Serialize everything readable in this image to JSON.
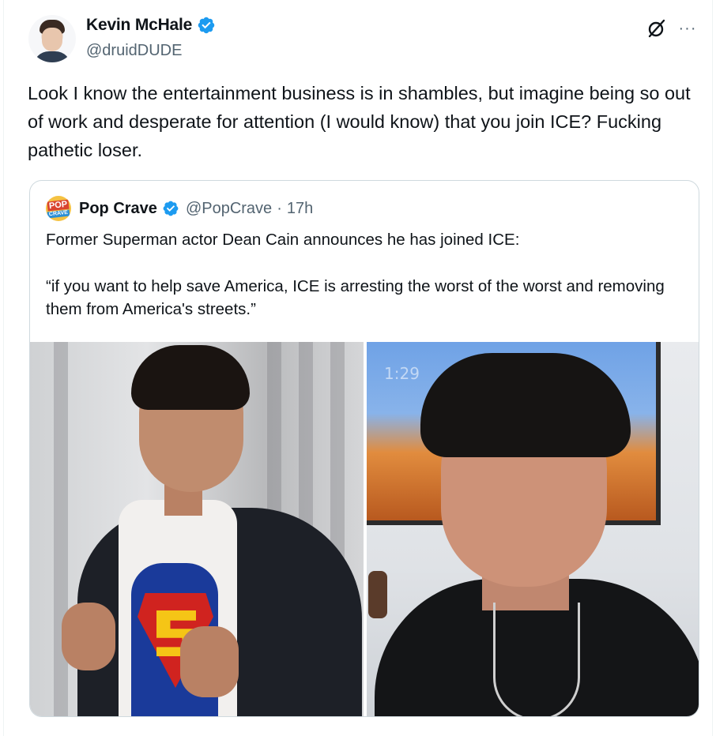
{
  "author": {
    "name": "Kevin McHale",
    "handle": "@druidDUDE",
    "verified": true,
    "avatar": "avatar-photo"
  },
  "actions": {
    "grok_icon": "grok-icon",
    "more_label": "···"
  },
  "tweet": {
    "text": "Look I know the entertainment business is in shambles, but imagine being so out of work and desperate for attention (I would know) that you join ICE? Fucking pathetic loser."
  },
  "quote": {
    "name": "Pop Crave",
    "handle": "@PopCrave",
    "separator": "·",
    "time": "17h",
    "verified": true,
    "logo_text_top": "POP",
    "logo_text_bottom": "CRAVE",
    "paragraph1": "Former Superman actor Dean Cain announces he has joined ICE:",
    "paragraph2": "“if you want to help save America, ICE is arresting the worst of the worst and removing them from America's streets.”",
    "media": {
      "left_image": "superman-photo",
      "right_image": "selfie-photo",
      "tv_clock": "1:29"
    }
  },
  "colors": {
    "verified_blue": "#1d9bf0",
    "text_primary": "#0f1419",
    "text_secondary": "#536471",
    "border": "#cfd9de"
  }
}
